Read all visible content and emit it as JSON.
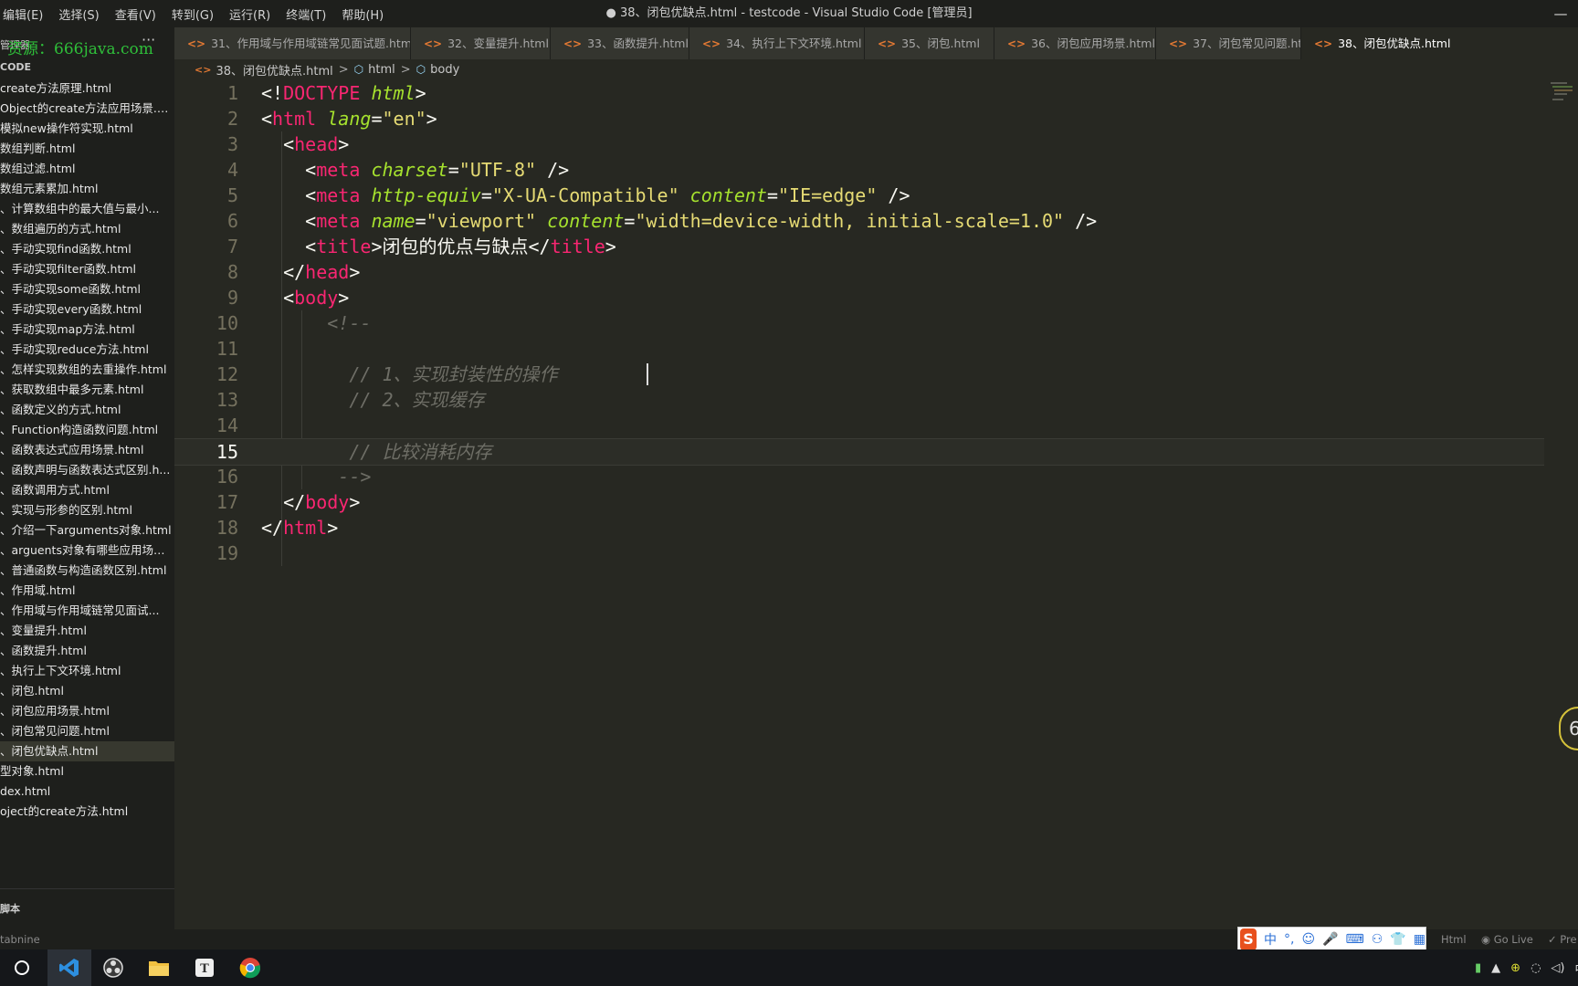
{
  "window": {
    "menu": [
      "编辑(E)",
      "选择(S)",
      "查看(V)",
      "转到(G)",
      "运行(R)",
      "终端(T)",
      "帮助(H)"
    ],
    "title": "● 38、闭包优缺点.html - testcode - Visual Studio Code [管理员]",
    "minimize": "—"
  },
  "sidebar": {
    "title": "管理器",
    "watermark": "资源：666java.com",
    "more": "···",
    "section": "CODE",
    "files": [
      "create方法原理.html",
      "Object的create方法应用场景.h...",
      "模拟new操作符实现.html",
      "数组判断.html",
      "数组过滤.html",
      "数组元素累加.html",
      "、计算数组中的最大值与最小...",
      "、数组遍历的方式.html",
      "、手动实现find函数.html",
      "、手动实现filter函数.html",
      "、手动实现some函数.html",
      "、手动实现every函数.html",
      "、手动实现map方法.html",
      "、手动实现reduce方法.html",
      "、怎样实现数组的去重操作.html",
      "、获取数组中最多元素.html",
      "、函数定义的方式.html",
      "、Function构造函数问题.html",
      "、函数表达式应用场景.html",
      "、函数声明与函数表达式区别.h...",
      "、函数调用方式.html",
      "、实现与形参的区别.html",
      "、介绍一下arguments对象.html",
      "、arguents对象有哪些应用场景...",
      "、普通函数与构造函数区别.html",
      "、作用域.html",
      "、作用域与作用域链常见面试...",
      "、变量提升.html",
      "、函数提升.html",
      "、执行上下文环境.html",
      "、闭包.html",
      "、闭包应用场景.html",
      "、闭包常见问题.html",
      "、闭包优缺点.html",
      "型对象.html",
      "dex.html",
      "oject的create方法.html"
    ],
    "active_index": 33,
    "scripts_label": "脚本"
  },
  "tabs": [
    {
      "label": "31、作用域与作用域链常见面试题.html",
      "icon": "<>"
    },
    {
      "label": "32、变量提升.html",
      "icon": "<>"
    },
    {
      "label": "33、函数提升.html",
      "icon": "<>"
    },
    {
      "label": "34、执行上下文环境.html",
      "icon": "<>"
    },
    {
      "label": "35、闭包.html",
      "icon": "<>"
    },
    {
      "label": "36、闭包应用场景.html",
      "icon": "<>"
    },
    {
      "label": "37、闭包常见问题.html",
      "icon": "<>"
    },
    {
      "label": "38、闭包优缺点.html",
      "icon": "<>"
    }
  ],
  "breadcrumb": {
    "file": "38、闭包优缺点.html",
    "el1": "html",
    "el2": "body",
    "sep": ">"
  },
  "editor": {
    "current_line": 15,
    "lines": [
      [
        [
          "p",
          "<!"
        ],
        [
          "t",
          "DOCTYPE"
        ],
        [
          "p",
          " "
        ],
        [
          "a",
          "html"
        ],
        [
          "p",
          ">"
        ]
      ],
      [
        [
          "p",
          "<"
        ],
        [
          "t",
          "html"
        ],
        [
          "p",
          " "
        ],
        [
          "a",
          "lang"
        ],
        [
          "p",
          "="
        ],
        [
          "s",
          "\"en\""
        ],
        [
          "p",
          ">"
        ]
      ],
      [
        [
          "p",
          "  <"
        ],
        [
          "t",
          "head"
        ],
        [
          "p",
          ">"
        ]
      ],
      [
        [
          "p",
          "    <"
        ],
        [
          "t",
          "meta"
        ],
        [
          "p",
          " "
        ],
        [
          "a",
          "charset"
        ],
        [
          "p",
          "="
        ],
        [
          "s",
          "\"UTF-8\""
        ],
        [
          "p",
          " />"
        ]
      ],
      [
        [
          "p",
          "    <"
        ],
        [
          "t",
          "meta"
        ],
        [
          "p",
          " "
        ],
        [
          "a",
          "http-equiv"
        ],
        [
          "p",
          "="
        ],
        [
          "s",
          "\"X-UA-Compatible\""
        ],
        [
          "p",
          " "
        ],
        [
          "a",
          "content"
        ],
        [
          "p",
          "="
        ],
        [
          "s",
          "\"IE=edge\""
        ],
        [
          "p",
          " />"
        ]
      ],
      [
        [
          "p",
          "    <"
        ],
        [
          "t",
          "meta"
        ],
        [
          "p",
          " "
        ],
        [
          "a",
          "name"
        ],
        [
          "p",
          "="
        ],
        [
          "s",
          "\"viewport\""
        ],
        [
          "p",
          " "
        ],
        [
          "a",
          "content"
        ],
        [
          "p",
          "="
        ],
        [
          "s",
          "\"width=device-width, initial-scale=1.0\""
        ],
        [
          "p",
          " />"
        ]
      ],
      [
        [
          "p",
          "    <"
        ],
        [
          "t",
          "title"
        ],
        [
          "p",
          ">闭包的优点与缺点</"
        ],
        [
          "t",
          "title"
        ],
        [
          "p",
          ">"
        ]
      ],
      [
        [
          "p",
          "  </"
        ],
        [
          "t",
          "head"
        ],
        [
          "p",
          ">"
        ]
      ],
      [
        [
          "p",
          "  <"
        ],
        [
          "t",
          "body"
        ],
        [
          "p",
          ">"
        ]
      ],
      [
        [
          "c",
          "      <!--"
        ]
      ],
      [
        [
          "c",
          ""
        ]
      ],
      [
        [
          "c",
          "        // 1、实现封装性的操作"
        ]
      ],
      [
        [
          "c",
          "        // 2、实现缓存"
        ]
      ],
      [
        [
          "c",
          ""
        ]
      ],
      [
        [
          "c",
          "        // 比较消耗内存"
        ]
      ],
      [
        [
          "c",
          "       -->"
        ]
      ],
      [
        [
          "p",
          "  </"
        ],
        [
          "t",
          "body"
        ],
        [
          "p",
          ">"
        ]
      ],
      [
        [
          "p",
          "</"
        ],
        [
          "t",
          "html"
        ],
        [
          "p",
          ">"
        ]
      ],
      [
        [
          "p",
          ""
        ]
      ]
    ]
  },
  "right_badge": "6",
  "statusbar": {
    "tabnine": "tabnine",
    "language": "Html",
    "golive": "Go Live",
    "prettier": "✓ Pre",
    "ime_logo": "S",
    "ime_mode": "中",
    "ime_punct": "°,"
  },
  "taskbar": {
    "tray": [
      "▲",
      "中"
    ]
  }
}
